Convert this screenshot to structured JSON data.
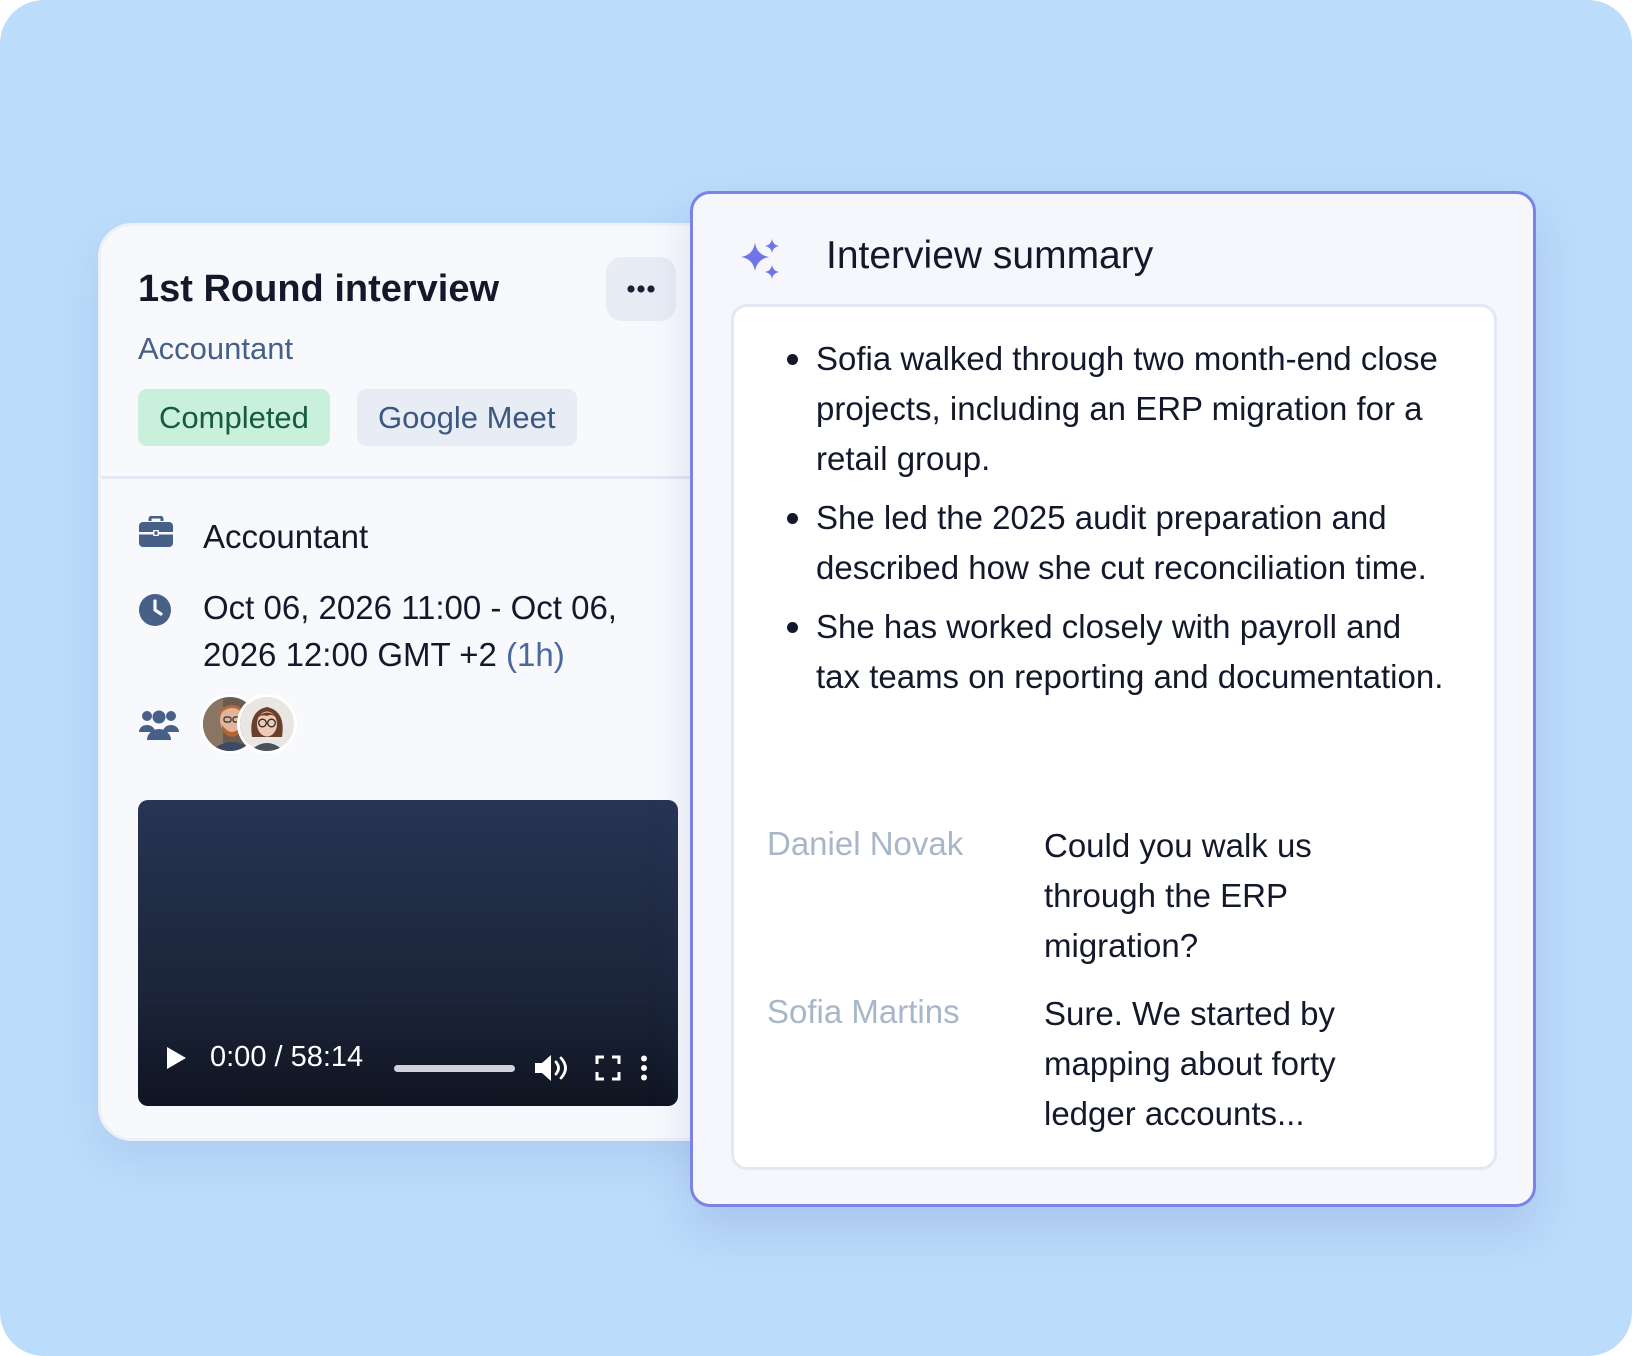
{
  "interview_card": {
    "title": "1st Round interview",
    "subtitle": "Accountant",
    "status_badge": "Completed",
    "platform_badge": "Google Meet",
    "job": "Accountant",
    "datetime": "Oct 06, 2026 11:00 - Oct 06, 2026 12:00 GMT +2",
    "duration": "(1h)",
    "participants_icon": "users-icon",
    "video": {
      "time": "0:00 / 58:14",
      "progress": 0
    }
  },
  "summary": {
    "title": "Interview summary",
    "icon": "sparkles-icon",
    "bullets": [
      "Sofia walked through two month-end close projects, including an ERP migration for a retail group.",
      "She led the 2025 audit preparation and described how she cut reconciliation time.",
      "She has worked closely with payroll and tax teams on reporting and documentation."
    ],
    "transcript": [
      {
        "speaker": "Daniel Novak",
        "text": "Could you walk us through the ERP migration?"
      },
      {
        "speaker": "Sofia Martins",
        "text": "Sure. We started by mapping about forty ledger accounts..."
      }
    ]
  },
  "colors": {
    "background": "#bcdcfb",
    "accent": "#7a83e6",
    "completed_bg": "#c9f0da",
    "completed_text": "#175b3c",
    "muted_speaker": "#a8b6c9"
  }
}
